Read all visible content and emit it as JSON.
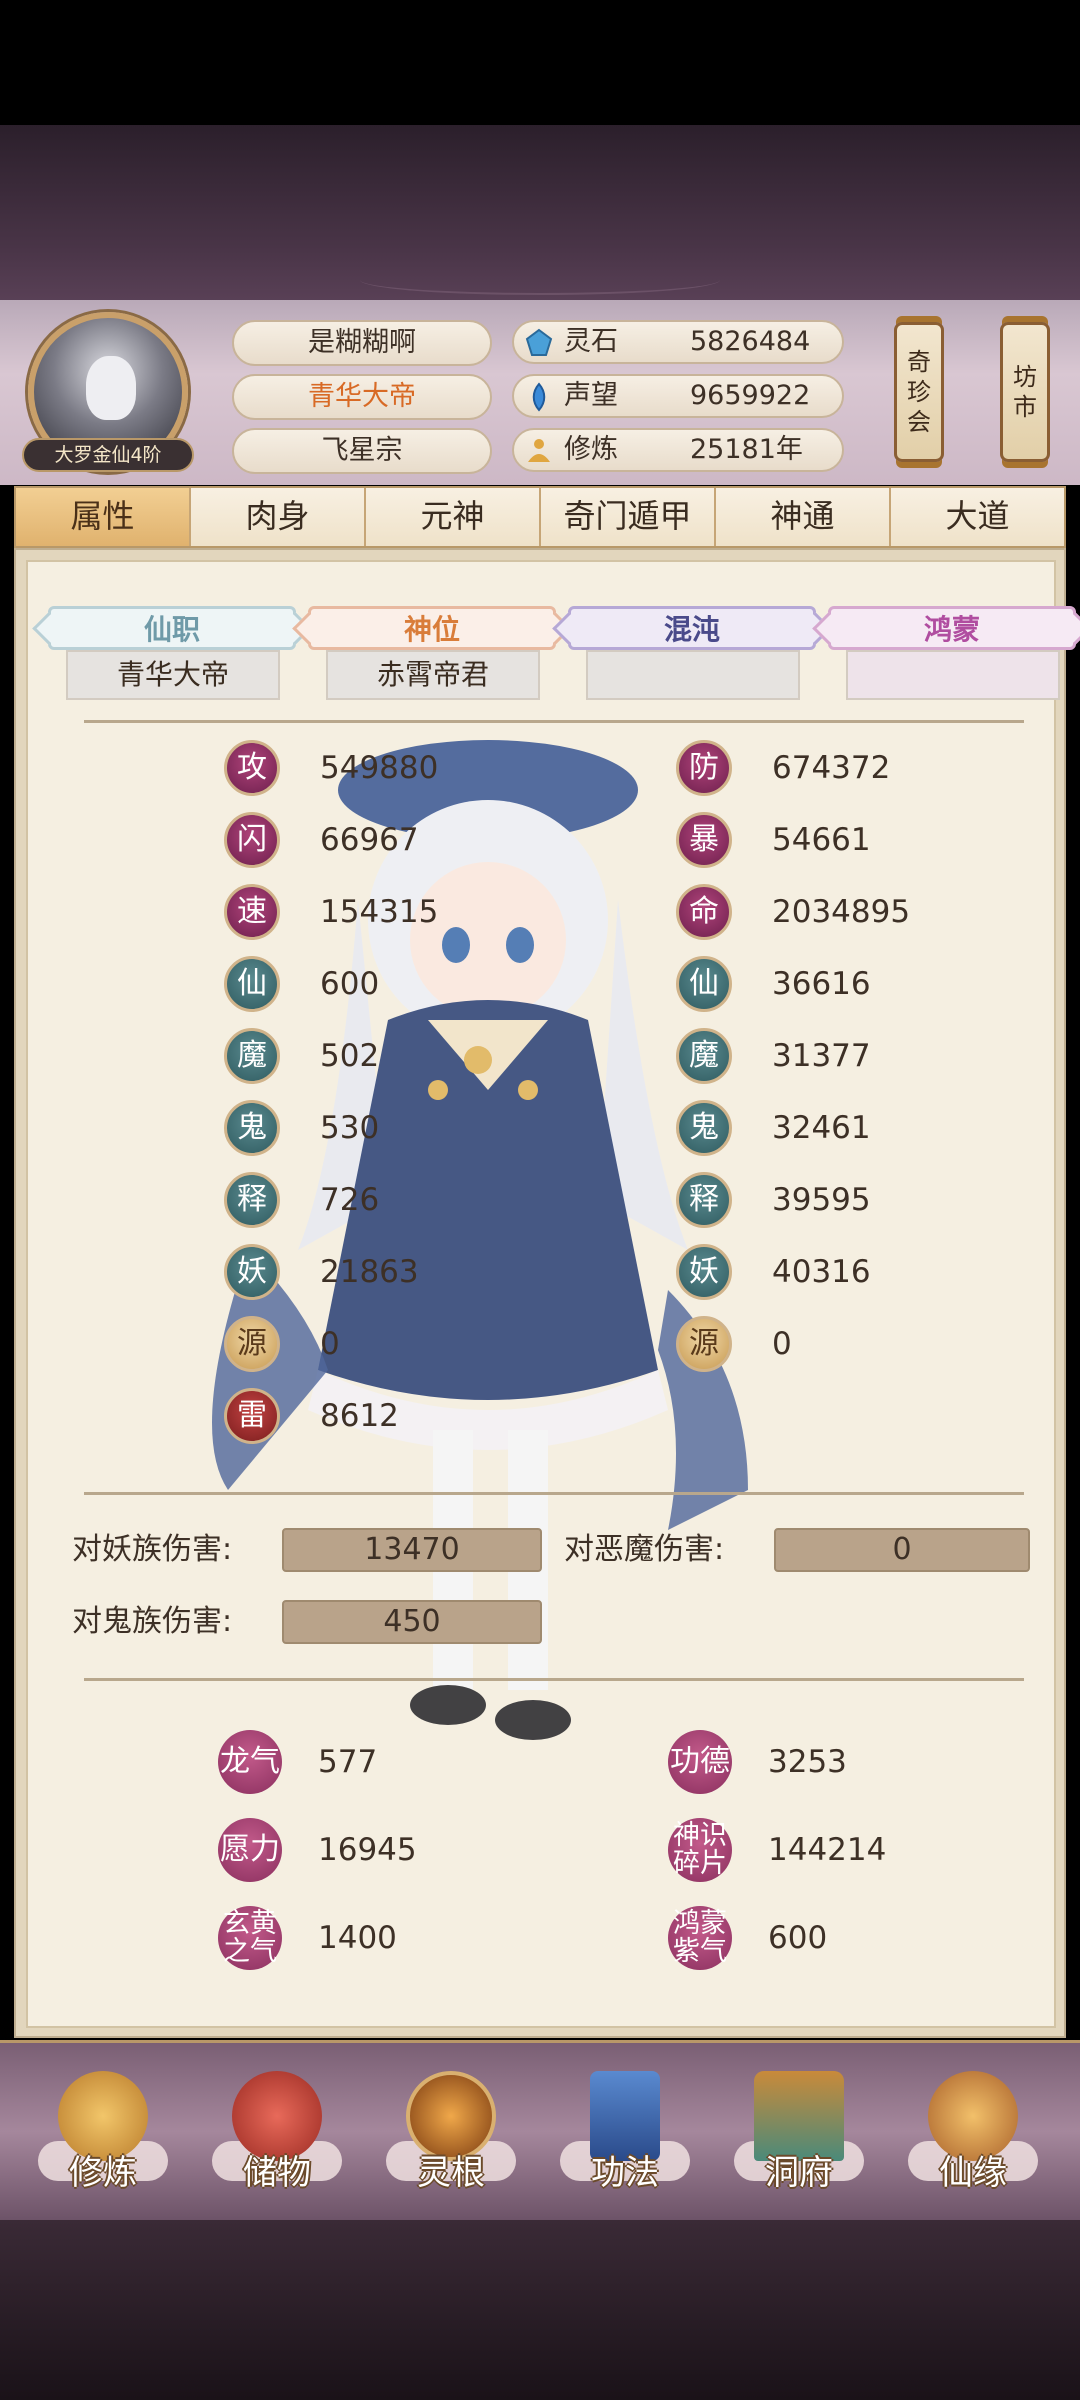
{
  "player": {
    "rank": "大罗金仙4阶",
    "name": "是糊糊啊",
    "title": "青华大帝",
    "sect": "飞星宗"
  },
  "resources": [
    {
      "icon": "spirit-stone-icon",
      "label": "灵石",
      "value": "5826484"
    },
    {
      "icon": "reputation-icon",
      "label": "声望",
      "value": "9659922"
    },
    {
      "icon": "cultivation-icon",
      "label": "修炼",
      "value": "25181年"
    }
  ],
  "side_buttons": {
    "treasure": [
      "奇",
      "珍",
      "会"
    ],
    "market": [
      "坊",
      "市"
    ]
  },
  "tabs": [
    "属性",
    "肉身",
    "元神",
    "奇门遁甲",
    "神通",
    "大道"
  ],
  "categories": [
    {
      "label": "仙职",
      "value": "青华大帝",
      "color": "#6f9aa8"
    },
    {
      "label": "神位",
      "value": "赤霄帝君",
      "color": "#d97d3a"
    },
    {
      "label": "混沌",
      "value": "",
      "color": "#4a4a8a"
    },
    {
      "label": "鸿蒙",
      "value": "",
      "color": "#b04da0"
    }
  ],
  "stats_left": [
    {
      "icon": "攻",
      "value": "549880",
      "style": "magenta"
    },
    {
      "icon": "闪",
      "value": "66967",
      "style": "magenta"
    },
    {
      "icon": "速",
      "value": "154315",
      "style": "magenta"
    },
    {
      "icon": "仙",
      "value": "600",
      "style": "teal"
    },
    {
      "icon": "魔",
      "value": "502",
      "style": "teal"
    },
    {
      "icon": "鬼",
      "value": "530",
      "style": "teal"
    },
    {
      "icon": "释",
      "value": "726",
      "style": "teal"
    },
    {
      "icon": "妖",
      "value": "21863",
      "style": "teal"
    },
    {
      "icon": "源",
      "value": "0",
      "style": "gold"
    },
    {
      "icon": "雷",
      "value": "8612",
      "style": "red"
    }
  ],
  "stats_right": [
    {
      "icon": "防",
      "value": "674372",
      "style": "magenta"
    },
    {
      "icon": "暴",
      "value": "54661",
      "style": "magenta"
    },
    {
      "icon": "命",
      "value": "2034895",
      "style": "magenta"
    },
    {
      "icon": "仙",
      "value": "36616",
      "style": "teal"
    },
    {
      "icon": "魔",
      "value": "31377",
      "style": "teal"
    },
    {
      "icon": "鬼",
      "value": "32461",
      "style": "teal"
    },
    {
      "icon": "释",
      "value": "39595",
      "style": "teal"
    },
    {
      "icon": "妖",
      "value": "40316",
      "style": "teal"
    },
    {
      "icon": "源",
      "value": "0",
      "style": "gold"
    }
  ],
  "damage": [
    {
      "label": "对妖族伤害:",
      "value": "13470"
    },
    {
      "label": "对恶魔伤害:",
      "value": "0"
    },
    {
      "label": "对鬼族伤害:",
      "value": "450"
    }
  ],
  "extras": [
    {
      "icon": [
        "龙气"
      ],
      "value": "577"
    },
    {
      "icon": [
        "功德"
      ],
      "value": "3253"
    },
    {
      "icon": [
        "愿力"
      ],
      "value": "16945"
    },
    {
      "icon": [
        "神识",
        "碎片"
      ],
      "value": "144214"
    },
    {
      "icon": [
        "玄黄",
        "之气"
      ],
      "value": "1400"
    },
    {
      "icon": [
        "鸿蒙",
        "紫气"
      ],
      "value": "600"
    }
  ],
  "bottom_nav": [
    {
      "label": "修炼",
      "icon": "cultivate-icon",
      "color": "#d9a441"
    },
    {
      "label": "储物",
      "icon": "storage-bag-icon",
      "color": "#c8463a"
    },
    {
      "label": "灵根",
      "icon": "spirit-root-icon",
      "color": "#e08a2a"
    },
    {
      "label": "功法",
      "icon": "technique-book-icon",
      "color": "#3a6aa8"
    },
    {
      "label": "洞府",
      "icon": "cave-abode-icon",
      "color": "#3f8a7a"
    },
    {
      "label": "仙缘",
      "icon": "immortal-fate-icon",
      "color": "#c87a30"
    }
  ]
}
